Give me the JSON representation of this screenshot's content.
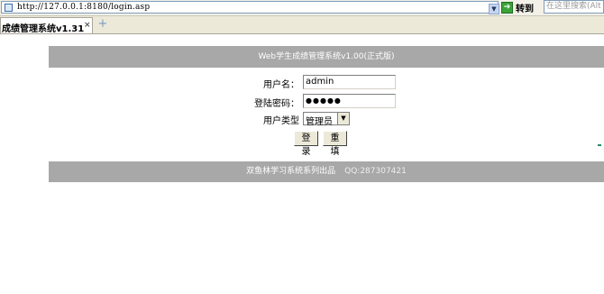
{
  "browser": {
    "url": "http://127.0.0.1:8180/login.asp",
    "go_label": "转到",
    "search_placeholder": "在这里搜索(Alt",
    "tab_title": "成绩管理系统v1.31",
    "tab_close": "×",
    "new_tab": "+"
  },
  "header": {
    "title": "Web学生成绩管理系统v1.00(正式版)"
  },
  "form": {
    "username_label": "用户名：",
    "username_value": "admin",
    "password_label": "登陆密码：",
    "password_value": "●●●●●",
    "usertype_label": "用户类型",
    "usertype_value": "管理员",
    "login_label": "登录",
    "reset_label": "重填"
  },
  "footer": {
    "text": "双鱼林学习系统系列出品",
    "qq": "QQ:287307421"
  }
}
